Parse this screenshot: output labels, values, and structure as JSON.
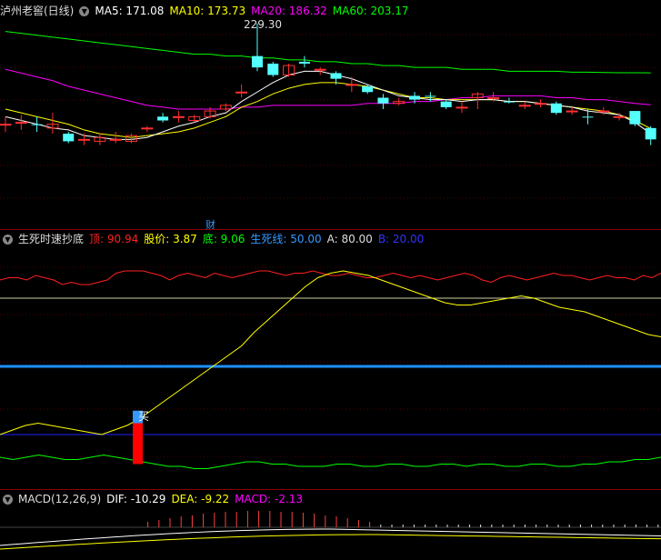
{
  "panel1": {
    "title": "泸州老窖(日线)",
    "ma5": "MA5: 171.08",
    "ma10": "MA10: 173.73",
    "ma20": "MA20: 186.32",
    "ma60": "MA60: 203.17",
    "high_label": "229.30",
    "cai_label": "财",
    "colors": {
      "ma5": "#ffffff",
      "ma10": "#ffff00",
      "ma20": "#ff00ff",
      "ma60": "#00ff00"
    },
    "candles": [
      {
        "o": 176,
        "c": 176,
        "h": 180,
        "l": 172,
        "up": true
      },
      {
        "o": 177,
        "c": 177,
        "h": 181,
        "l": 173,
        "up": true
      },
      {
        "o": 176,
        "c": 176,
        "h": 180,
        "l": 172,
        "up": false
      },
      {
        "o": 174,
        "c": 176,
        "h": 182,
        "l": 171,
        "up": true
      },
      {
        "o": 171,
        "c": 167,
        "h": 172,
        "l": 166,
        "up": false
      },
      {
        "o": 168,
        "c": 168,
        "h": 171,
        "l": 165,
        "up": true
      },
      {
        "o": 167,
        "c": 169,
        "h": 171,
        "l": 165,
        "up": true
      },
      {
        "o": 168,
        "c": 168,
        "h": 172,
        "l": 166,
        "up": true
      },
      {
        "o": 167,
        "c": 170,
        "h": 171,
        "l": 166,
        "up": true
      },
      {
        "o": 174,
        "c": 174,
        "h": 175,
        "l": 172,
        "up": true
      },
      {
        "o": 180,
        "c": 178,
        "h": 182,
        "l": 177,
        "up": false
      },
      {
        "o": 180,
        "c": 180,
        "h": 183,
        "l": 177,
        "up": true
      },
      {
        "o": 178,
        "c": 180,
        "h": 181,
        "l": 177,
        "up": true
      },
      {
        "o": 180,
        "c": 183,
        "h": 185,
        "l": 179,
        "up": true
      },
      {
        "o": 184,
        "c": 186,
        "h": 187,
        "l": 183,
        "up": true
      },
      {
        "o": 193,
        "c": 193,
        "h": 197,
        "l": 190,
        "up": true
      },
      {
        "o": 212,
        "c": 206,
        "h": 229.3,
        "l": 204,
        "up": false
      },
      {
        "o": 208,
        "c": 202,
        "h": 209,
        "l": 201,
        "up": false
      },
      {
        "o": 202,
        "c": 207,
        "h": 208,
        "l": 201,
        "up": true
      },
      {
        "o": 209,
        "c": 208,
        "h": 212,
        "l": 206,
        "up": false
      },
      {
        "o": 205,
        "c": 205,
        "h": 206,
        "l": 202,
        "up": true
      },
      {
        "o": 203,
        "c": 200,
        "h": 204,
        "l": 197,
        "up": false
      },
      {
        "o": 197,
        "c": 197,
        "h": 201,
        "l": 193,
        "up": true
      },
      {
        "o": 196,
        "c": 193,
        "h": 197,
        "l": 192,
        "up": false
      },
      {
        "o": 190,
        "c": 187,
        "h": 192,
        "l": 184,
        "up": false
      },
      {
        "o": 187,
        "c": 188,
        "h": 190,
        "l": 186,
        "up": true
      },
      {
        "o": 191,
        "c": 189,
        "h": 193,
        "l": 187,
        "up": false
      },
      {
        "o": 191,
        "c": 191,
        "h": 193,
        "l": 188,
        "up": false
      },
      {
        "o": 188,
        "c": 185,
        "h": 189,
        "l": 184,
        "up": false
      },
      {
        "o": 185,
        "c": 185,
        "h": 188,
        "l": 182,
        "up": true
      },
      {
        "o": 190,
        "c": 192,
        "h": 193,
        "l": 184,
        "up": true
      },
      {
        "o": 190,
        "c": 190,
        "h": 193,
        "l": 188,
        "up": true
      },
      {
        "o": 188,
        "c": 188,
        "h": 190,
        "l": 187,
        "up": false
      },
      {
        "o": 186,
        "c": 186,
        "h": 188,
        "l": 184,
        "up": true
      },
      {
        "o": 187,
        "c": 187,
        "h": 189,
        "l": 185,
        "up": true
      },
      {
        "o": 187,
        "c": 182,
        "h": 188,
        "l": 181,
        "up": false
      },
      {
        "o": 183,
        "c": 183,
        "h": 185,
        "l": 181,
        "up": true
      },
      {
        "o": 180,
        "c": 180,
        "h": 184,
        "l": 176,
        "up": false
      },
      {
        "o": 183,
        "c": 183,
        "h": 185,
        "l": 181,
        "up": true
      },
      {
        "o": 180,
        "c": 180,
        "h": 182,
        "l": 178,
        "up": true
      },
      {
        "o": 183,
        "c": 176,
        "h": 183,
        "l": 175,
        "up": false
      },
      {
        "o": 174,
        "c": 168,
        "h": 175,
        "l": 165,
        "up": false
      }
    ],
    "ma60_series": [
      225,
      224,
      223,
      222,
      221,
      220,
      219,
      218,
      217,
      216,
      215,
      214,
      213,
      213,
      212,
      212,
      211,
      211,
      210,
      210,
      209,
      209,
      208,
      208,
      207,
      207,
      206,
      206,
      206,
      205,
      205,
      205,
      204,
      204,
      204,
      204,
      203.5,
      203.5,
      203.3,
      203.2,
      203.2,
      203.17
    ],
    "ma20_series": [
      205,
      203,
      201,
      199,
      196,
      194,
      192,
      190,
      188,
      186,
      185,
      184,
      184,
      184,
      184,
      185,
      185,
      186,
      186,
      186,
      186,
      186,
      186,
      187,
      187,
      187,
      188,
      188,
      189,
      190,
      190,
      191,
      191,
      191,
      191,
      190,
      190,
      189,
      189,
      188,
      187,
      186.3
    ],
    "ma10_series": [
      184,
      182,
      180,
      178,
      176,
      173,
      171,
      170,
      169,
      170,
      171,
      172,
      174,
      177,
      180,
      185,
      188,
      192,
      195,
      197,
      198,
      198,
      197,
      196,
      194,
      192,
      190,
      190,
      189,
      189,
      189,
      189,
      188,
      188,
      187,
      186,
      185,
      184,
      183,
      181,
      178,
      173.7
    ],
    "ma5_series": [
      180,
      178,
      176,
      174,
      173,
      170,
      169,
      168,
      168,
      169,
      172,
      175,
      177,
      180,
      182,
      188,
      193,
      198,
      202,
      204,
      204,
      202,
      200,
      197,
      194,
      191,
      190,
      189,
      189,
      188,
      189,
      189,
      188,
      188,
      187,
      186,
      185,
      183,
      182,
      181,
      177,
      171
    ]
  },
  "panel2": {
    "title": "生死时速抄底",
    "ding": "顶: 90.94",
    "gujia": "股价: 3.87",
    "di": "底: 9.06",
    "shengsi": "生死线: 50.00",
    "a": "A: 80.00",
    "b": "B: 20.00",
    "buy_label": "买",
    "colors": {
      "ding": "#ff2020",
      "gujia": "#ffff00",
      "di": "#00ff00",
      "shengsi": "#3399ff",
      "a": "#dddddd",
      "b": "#3333ff"
    },
    "ding_series": [
      88,
      89,
      89,
      88,
      90,
      89,
      88,
      86,
      87,
      86,
      86,
      87,
      88,
      91,
      92,
      92,
      92,
      91,
      90,
      88,
      90,
      91,
      90,
      89,
      91,
      90,
      89,
      90,
      91,
      92,
      92,
      91,
      90,
      91,
      91,
      92,
      91,
      90,
      90,
      91,
      90,
      89,
      89,
      90,
      91,
      90,
      89,
      90,
      89,
      88,
      89,
      90,
      91,
      90,
      88,
      87,
      89,
      90,
      89,
      88,
      89,
      90,
      91,
      90,
      90,
      89,
      88,
      89,
      90,
      89,
      89,
      88,
      90,
      89,
      91
    ],
    "gujia_series": [
      20,
      22,
      24,
      25,
      24,
      23,
      22,
      21,
      20,
      22,
      24,
      27,
      31,
      35,
      39,
      43,
      47,
      51,
      55,
      59,
      65,
      70,
      75,
      80,
      85,
      89,
      91,
      92,
      91,
      90,
      88,
      86,
      84,
      82,
      80,
      78,
      77,
      77,
      78,
      79,
      80,
      81,
      80,
      78,
      76,
      75,
      74,
      72,
      70,
      68,
      66,
      64,
      63
    ],
    "di_series": [
      10,
      9,
      10,
      11,
      10,
      9,
      9,
      10,
      11,
      10,
      9,
      8,
      7,
      6,
      6,
      5,
      5,
      6,
      7,
      8,
      8,
      7,
      7,
      6,
      6,
      6,
      7,
      7,
      6,
      6,
      7,
      7,
      6,
      6,
      7,
      7,
      6,
      7,
      7,
      6,
      6,
      7,
      7,
      6,
      6,
      7,
      7,
      8,
      8,
      9,
      9,
      10
    ]
  },
  "panel3": {
    "title": "MACD(12,26,9)",
    "dif": "DIF: -10.29",
    "dea": "DEA: -9.22",
    "macd": "MACD: -2.13",
    "colors": {
      "dif": "#ffffff",
      "dea": "#ffff00",
      "macd": "#ff00ff"
    }
  }
}
